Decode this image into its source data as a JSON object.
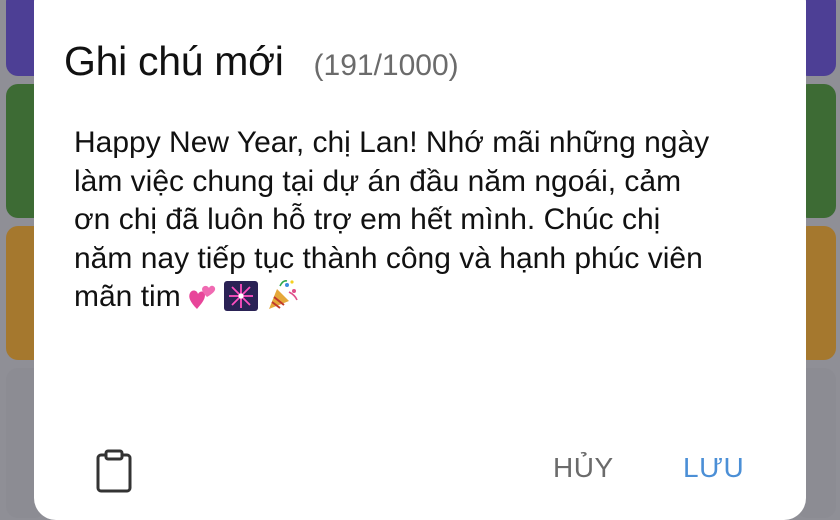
{
  "dialog": {
    "title": "Ghi chú mới",
    "counter": "(191/1000)",
    "text": "Happy New Year, chị Lan! Nhớ mãi những ngày làm việc chung tại dự án đầu năm ngoái, cảm ơn chị đã luôn hỗ trợ em hết mình. Chúc chị năm nay tiếp tục thành công và hạnh phúc viên mãn tim",
    "emojis": [
      "two-hearts",
      "fireworks",
      "party-popper"
    ],
    "cancel_label": "HỦY",
    "save_label": "LƯU",
    "clipboard_icon": "clipboard-icon"
  },
  "colors": {
    "accent": "#4b8fd6",
    "backdrop": "#8f8f96",
    "card_purple": "#4d3f95",
    "card_green": "#3d6b34",
    "card_orange": "#a5782e"
  }
}
